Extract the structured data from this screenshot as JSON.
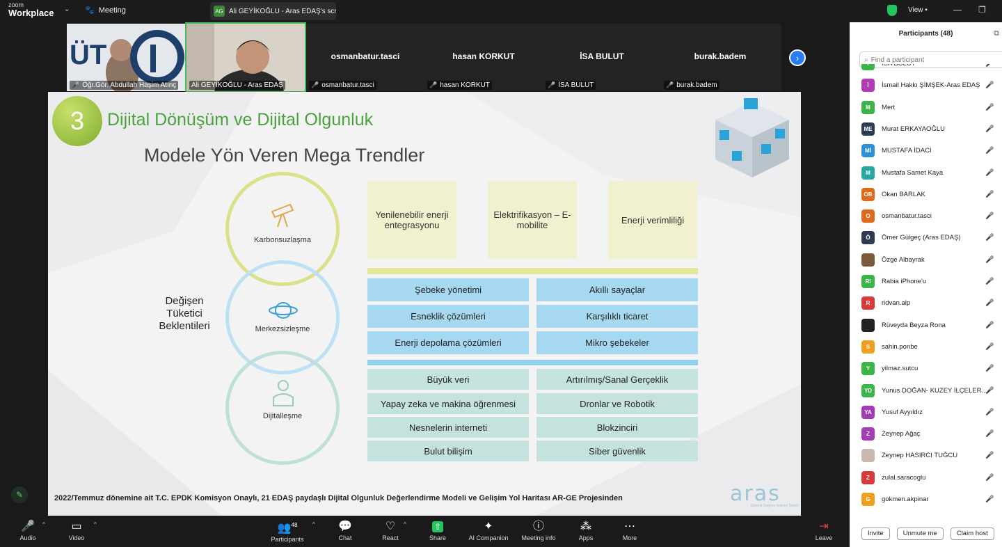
{
  "topbar": {
    "logo_line1": "zoom",
    "logo_line2": "Workplace",
    "meeting_label": "Meeting",
    "share_initials": "AG",
    "share_text": "Ali GEYİKOĞLU - Aras EDAŞ's scre",
    "view_label": "View"
  },
  "strip": {
    "video1_label": "Öğr.Gör. Abdullah Haşim Atınç",
    "video2_label": "Ali GEYİKOĞLU - Aras EDAŞ",
    "tiles": [
      {
        "name": "osmanbatur.tasci",
        "label": "osmanbatur.tasci"
      },
      {
        "name": "hasan KORKUT",
        "label": "hasan KORKUT"
      },
      {
        "name": "İSA BULUT",
        "label": "İSA BULUT"
      },
      {
        "name": "burak.badem",
        "label": "burak.badem"
      }
    ]
  },
  "slide": {
    "number": "3",
    "title": "Dijital Dönüşüm ve Dijital Olgunluk",
    "subtitle": "Modele Yön Veren Mega Trendler",
    "consumer_lines": [
      "Değişen",
      "Tüketici",
      "Beklentileri"
    ],
    "rings": [
      "Karbonsuzlaşma",
      "Merkezsizleşme",
      "Dijitalleşme"
    ],
    "yellow_boxes": [
      "Yenilenebilir enerji entegrasyonu",
      "Elektrifikasyon – E-mobilite",
      "Enerji verimliliği"
    ],
    "blue_cells": [
      "Şebeke yönetimi",
      "Akıllı sayaçlar",
      "Esneklik çözümleri",
      "Karşılıklı ticaret",
      "Enerji depolama çözümleri",
      "Mikro şebekeler"
    ],
    "green_cells": [
      "Büyük veri",
      "Artırılmış/Sanal Gerçeklik",
      "Yapay zeka ve makina öğrenmesi",
      "Dronlar ve Robotik",
      "Nesnelerin interneti",
      "Blokzinciri",
      "Bulut bilişim",
      "Siber güvenlik"
    ],
    "footer": "2022/Temmuz dönemine ait T.C. EPDK Komisyon Onaylı, 21 EDAŞ paydaşlı Dijital Olgunluk Değerlendirme Modeli ve Gelişim Yol Haritası AR-GE Projesinden",
    "logo_text": "aras",
    "logo_sub": "Elektrik Dağıtım Anonim Şirketi"
  },
  "toolbar": {
    "audio": "Audio",
    "video": "Video",
    "participants": "Participants",
    "participants_count": "48",
    "chat": "Chat",
    "react": "React",
    "share": "Share",
    "ai": "AI Companion",
    "info": "Meeting info",
    "apps": "Apps",
    "more": "More",
    "leave": "Leave"
  },
  "panel": {
    "title": "Participants (48)",
    "search_placeholder": "Find a participant",
    "participants": [
      {
        "initials": "İ",
        "name": "İSA BULUT",
        "color": "#3bb54a"
      },
      {
        "initials": "İ",
        "name": "İsmail Hakkı ŞİMŞEK-Aras EDAŞ",
        "color": "#b23cb5"
      },
      {
        "initials": "M",
        "name": "Mert",
        "color": "#3bb54a"
      },
      {
        "initials": "ME",
        "name": "Murat ERKAYAOĞLU",
        "color": "#2f3b52"
      },
      {
        "initials": "Mİ",
        "name": "MUSTAFA İDACI",
        "color": "#2d8fd6"
      },
      {
        "initials": "M",
        "name": "Mustafa Samet Kaya",
        "color": "#2aa6a1"
      },
      {
        "initials": "OB",
        "name": "Okan BARLAK",
        "color": "#e06a1b"
      },
      {
        "initials": "O",
        "name": "osmanbatur.tasci",
        "color": "#e06a1b"
      },
      {
        "initials": "Ö",
        "name": "Ömer Gülgeç (Aras EDAŞ)",
        "color": "#2f3b52"
      },
      {
        "initials": "",
        "name": "Özge Albayrak",
        "color": "#7a5a3a"
      },
      {
        "initials": "RI",
        "name": "Rabia iPhone'u",
        "color": "#3bb54a"
      },
      {
        "initials": "R",
        "name": "ridvan.alp",
        "color": "#d63a3a"
      },
      {
        "initials": "",
        "name": "Rüveyda Beyza Rona",
        "color": "#222222"
      },
      {
        "initials": "S",
        "name": "sahin.ponbe",
        "color": "#f0a020"
      },
      {
        "initials": "Y",
        "name": "yilmaz.sutcu",
        "color": "#3bb54a"
      },
      {
        "initials": "YD",
        "name": "Yunus DOĞAN- KUZEY İLÇELER...",
        "color": "#3bb54a"
      },
      {
        "initials": "YA",
        "name": "Yusuf Ayyıldız",
        "color": "#a33cb5"
      },
      {
        "initials": "Z",
        "name": "Zeynep Ağaç",
        "color": "#a33cb5"
      },
      {
        "initials": "",
        "name": "Zeynep HASIRCI TUĞCU",
        "color": "#c8b8b0"
      },
      {
        "initials": "Z",
        "name": "zulal.saracoglu",
        "color": "#d63a3a"
      },
      {
        "initials": "G",
        "name": "gokmen.akpinar",
        "color": "#f0a020"
      }
    ],
    "invite": "Invite",
    "unmute": "Unmute me",
    "claim": "Claim host"
  }
}
